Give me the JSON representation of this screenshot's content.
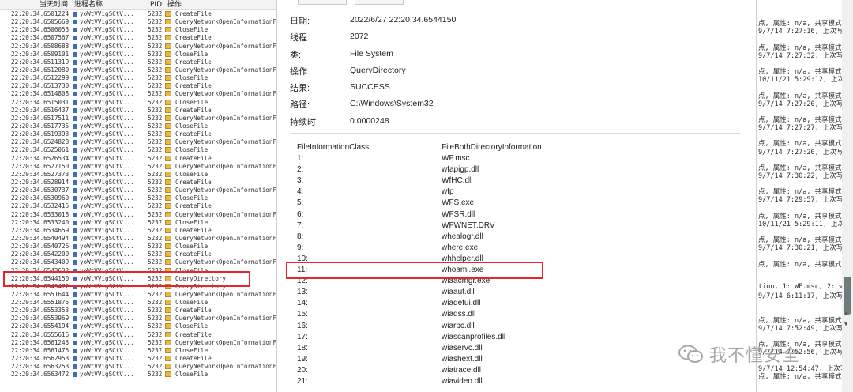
{
  "list": {
    "columns": {
      "time": "当天时间",
      "process": "进程名称",
      "pid": "PID",
      "operation": "操作"
    },
    "rows": [
      {
        "time": "22:20:34.6501224",
        "process": "yoWtVVigSCtV...",
        "pid": "5232",
        "op": "CreateFile"
      },
      {
        "time": "22:20:34.6505669",
        "process": "yoWtVVigSCtV...",
        "pid": "5232",
        "op": "QueryNetworkOpenInformationF"
      },
      {
        "time": "22:20:34.6506053",
        "process": "yoWtVVigSCtV...",
        "pid": "5232",
        "op": "CloseFile"
      },
      {
        "time": "22:20:34.6507567",
        "process": "yoWtVVigSCtV...",
        "pid": "5232",
        "op": "CreateFile"
      },
      {
        "time": "22:20:34.6508688",
        "process": "yoWtVVigSCtV...",
        "pid": "5232",
        "op": "QueryNetworkOpenInformationF"
      },
      {
        "time": "22:20:34.6509101",
        "process": "yoWtVVigSCtV...",
        "pid": "5232",
        "op": "CloseFile"
      },
      {
        "time": "22:20:34.6511319",
        "process": "yoWtVVigSCtV...",
        "pid": "5232",
        "op": "CreateFile"
      },
      {
        "time": "22:20:34.6512080",
        "process": "yoWtVVigSCtV...",
        "pid": "5232",
        "op": "QueryNetworkOpenInformationF"
      },
      {
        "time": "22:20:34.6512299",
        "process": "yoWtVVigSCtV...",
        "pid": "5232",
        "op": "CloseFile"
      },
      {
        "time": "22:20:34.6513730",
        "process": "yoWtVVigSCtV...",
        "pid": "5232",
        "op": "CreateFile"
      },
      {
        "time": "22:20:34.6514808",
        "process": "yoWtVVigSCtV...",
        "pid": "5232",
        "op": "QueryNetworkOpenInformationF"
      },
      {
        "time": "22:20:34.6515031",
        "process": "yoWtVVigSCtV...",
        "pid": "5232",
        "op": "CloseFile"
      },
      {
        "time": "22:20:34.6516437",
        "process": "yoWtVVigSCtV...",
        "pid": "5232",
        "op": "CreateFile"
      },
      {
        "time": "22:20:34.6517511",
        "process": "yoWtVVigSCtV...",
        "pid": "5232",
        "op": "QueryNetworkOpenInformationF"
      },
      {
        "time": "22:20:34.6517735",
        "process": "yoWtVVigSCtV...",
        "pid": "5232",
        "op": "CloseFile"
      },
      {
        "time": "22:20:34.6519393",
        "process": "yoWtVVigSCtV...",
        "pid": "5232",
        "op": "CreateFile"
      },
      {
        "time": "22:20:34.6524828",
        "process": "yoWtVVigSCtV...",
        "pid": "5232",
        "op": "QueryNetworkOpenInformationF"
      },
      {
        "time": "22:20:34.6525061",
        "process": "yoWtVVigSCtV...",
        "pid": "5232",
        "op": "CloseFile"
      },
      {
        "time": "22:20:34.6526534",
        "process": "yoWtVVigSCtV...",
        "pid": "5232",
        "op": "CreateFile"
      },
      {
        "time": "22:20:34.6527150",
        "process": "yoWtVVigSCtV...",
        "pid": "5232",
        "op": "QueryNetworkOpenInformationF"
      },
      {
        "time": "22:20:34.6527373",
        "process": "yoWtVVigSCtV...",
        "pid": "5232",
        "op": "CloseFile"
      },
      {
        "time": "22:20:34.6528914",
        "process": "yoWtVVigSCtV...",
        "pid": "5232",
        "op": "CreateFile"
      },
      {
        "time": "22:20:34.6530737",
        "process": "yoWtVVigSCtV...",
        "pid": "5232",
        "op": "QueryNetworkOpenInformationF"
      },
      {
        "time": "22:20:34.6530960",
        "process": "yoWtVVigSCtV...",
        "pid": "5232",
        "op": "CloseFile"
      },
      {
        "time": "22:20:34.6532415",
        "process": "yoWtVVigSCtV...",
        "pid": "5232",
        "op": "CreateFile"
      },
      {
        "time": "22:20:34.6533018",
        "process": "yoWtVVigSCtV...",
        "pid": "5232",
        "op": "QueryNetworkOpenInformationF"
      },
      {
        "time": "22:20:34.6533240",
        "process": "yoWtVVigSCtV...",
        "pid": "5232",
        "op": "CloseFile"
      },
      {
        "time": "22:20:34.6534659",
        "process": "yoWtVVigSCtV...",
        "pid": "5232",
        "op": "CreateFile"
      },
      {
        "time": "22:20:34.6540494",
        "process": "yoWtVVigSCtV...",
        "pid": "5232",
        "op": "QueryNetworkOpenInformationF"
      },
      {
        "time": "22:20:34.6540726",
        "process": "yoWtVVigSCtV...",
        "pid": "5232",
        "op": "CloseFile"
      },
      {
        "time": "22:20:34.6542200",
        "process": "yoWtVVigSCtV...",
        "pid": "5232",
        "op": "CreateFile"
      },
      {
        "time": "22:20:34.6543409",
        "process": "yoWtVVigSCtV...",
        "pid": "5232",
        "op": "QueryNetworkOpenInformationF"
      },
      {
        "time": "22:20:34.6543632",
        "process": "yoWtVVigSCtV...",
        "pid": "5232",
        "op": "CloseFile"
      },
      {
        "time": "22:20:34.6544150",
        "process": "yoWtVVigSCtV...",
        "pid": "5232",
        "op": "QueryDirectory"
      },
      {
        "time": "22:20:34.6549472",
        "process": "yoWtVVigSCtV...",
        "pid": "5232",
        "op": "QueryDirectory"
      },
      {
        "time": "22:20:34.6551644",
        "process": "yoWtVVigSCtV...",
        "pid": "5232",
        "op": "QueryNetworkOpenInformationF"
      },
      {
        "time": "22:20:34.6551875",
        "process": "yoWtVVigSCtV...",
        "pid": "5232",
        "op": "CloseFile"
      },
      {
        "time": "22:20:34.6553353",
        "process": "yoWtVVigSCtV...",
        "pid": "5232",
        "op": "CreateFile"
      },
      {
        "time": "22:20:34.6553969",
        "process": "yoWtVVigSCtV...",
        "pid": "5232",
        "op": "QueryNetworkOpenInformationF"
      },
      {
        "time": "22:20:34.6554194",
        "process": "yoWtVVigSCtV...",
        "pid": "5232",
        "op": "CloseFile"
      },
      {
        "time": "22:20:34.6555616",
        "process": "yoWtVVigSCtV...",
        "pid": "5232",
        "op": "CreateFile"
      },
      {
        "time": "22:20:34.6561243",
        "process": "yoWtVVigSCtV...",
        "pid": "5232",
        "op": "QueryNetworkOpenInformationF"
      },
      {
        "time": "22:20:34.6561475",
        "process": "yoWtVVigSCtV...",
        "pid": "5232",
        "op": "CloseFile"
      },
      {
        "time": "22:20:34.6562953",
        "process": "yoWtVVigSCtV...",
        "pid": "5232",
        "op": "CreateFile"
      },
      {
        "time": "22:20:34.6563253",
        "process": "yoWtVVigSCtV...",
        "pid": "5232",
        "op": "QueryNetworkOpenInformationF"
      },
      {
        "time": "22:20:34.6563472",
        "process": "yoWtVVigSCtV...",
        "pid": "5232",
        "op": "CloseFile"
      }
    ]
  },
  "event": {
    "date_label": "日期:",
    "date": "2022/6/27 22:20:34.6544150",
    "thread_label": "线程:",
    "thread": "2072",
    "class_label": "类:",
    "class": "File System",
    "operation_label": "操作:",
    "operation": "QueryDirectory",
    "result_label": "结果:",
    "result": "SUCCESS",
    "path_label": "路径:",
    "path": "C:\\Windows\\System32",
    "duration_label": "持续时",
    "duration": "0.0000248"
  },
  "details": {
    "header_key": "FileInformationClass:",
    "header_value": "FileBothDirectoryInformation",
    "items": [
      {
        "key": "1:",
        "value": "WF.msc"
      },
      {
        "key": "2:",
        "value": "wfapigp.dll"
      },
      {
        "key": "3:",
        "value": "WfHC.dll"
      },
      {
        "key": "4:",
        "value": "wfp"
      },
      {
        "key": "5:",
        "value": "WFS.exe"
      },
      {
        "key": "6:",
        "value": "WFSR.dll"
      },
      {
        "key": "7:",
        "value": "WFWNET.DRV"
      },
      {
        "key": "8:",
        "value": "whealogr.dll"
      },
      {
        "key": "9:",
        "value": "where.exe"
      },
      {
        "key": "10:",
        "value": "whhelper.dll"
      },
      {
        "key": "11:",
        "value": "whoami.exe"
      },
      {
        "key": "12:",
        "value": "wiaacmgr.exe"
      },
      {
        "key": "13:",
        "value": "wiaaut.dll"
      },
      {
        "key": "14:",
        "value": "wiadefui.dll"
      },
      {
        "key": "15:",
        "value": "wiadss.dll"
      },
      {
        "key": "16:",
        "value": "wiarpc.dll"
      },
      {
        "key": "17:",
        "value": "wiascanprofiles.dll"
      },
      {
        "key": "18:",
        "value": "wiaservc.dll"
      },
      {
        "key": "19:",
        "value": "wiashext.dll"
      },
      {
        "key": "20:",
        "value": "wiatrace.dll"
      },
      {
        "key": "21:",
        "value": "wiavideo.dll"
      }
    ]
  },
  "right_log": [
    {
      "t": "点, 属性: n/a, 共享模式",
      "row": 1
    },
    {
      "t": "9/7/14 7:27:16, 上次写入",
      "row": 2
    },
    {
      "t": "点, 属性: n/a, 共享模式",
      "row": 4
    },
    {
      "t": "9/7/14 7:27:32, 上次写入",
      "row": 5
    },
    {
      "t": "点, 属性: n/a, 共享模式",
      "row": 7
    },
    {
      "t": "10/11/21 5:29:12, 上次写",
      "row": 8
    },
    {
      "t": "点, 属性: n/a, 共享模式",
      "row": 10
    },
    {
      "t": "9/7/14 7:27:20, 上次写入",
      "row": 11
    },
    {
      "t": "点, 属性: n/a, 共享模式",
      "row": 13
    },
    {
      "t": "9/7/14 7:27:27, 上次写入",
      "row": 14
    },
    {
      "t": "点, 属性: n/a, 共享模式",
      "row": 16
    },
    {
      "t": "9/7/14 7:27:20, 上次写入",
      "row": 17
    },
    {
      "t": "点, 属性: n/a, 共享模式",
      "row": 19
    },
    {
      "t": "9/7/14 7:30:22, 上次写入",
      "row": 20
    },
    {
      "t": "点, 属性: n/a, 共享模式",
      "row": 22
    },
    {
      "t": "9/7/14 7:29:57, 上次写入",
      "row": 23
    },
    {
      "t": "点, 属性: n/a, 共享模式",
      "row": 25
    },
    {
      "t": "10/11/21 5:29:11, 上次写",
      "row": 26
    },
    {
      "t": "点, 属性: n/a, 共享模式",
      "row": 28
    },
    {
      "t": "9/7/14 7:30:21, 上次写入",
      "row": 29
    },
    {
      "t": "点, 属性: n/a, 共享模式",
      "row": 31
    },
    {
      "t": "tion, 1: WF.msc, 2: wfap",
      "row": 34
    },
    {
      "t": "9/7/14 6:11:17, 上次写入",
      "row": 35
    },
    {
      "t": "点, 属性: n/a, 共享模式",
      "row": 38
    },
    {
      "t": "9/7/14 7:52:49, 上次写入",
      "row": 39
    },
    {
      "t": "点, 属性: n/a, 共享模式",
      "row": 41
    },
    {
      "t": "9/7/14 7:52:56, 上次写入",
      "row": 42
    },
    {
      "t": "9/7/14 12:54:47, 上次写",
      "row": 44
    },
    {
      "t": "点, 属性: n/a, 共享模式",
      "row": 45
    }
  ],
  "watermark": {
    "text": "我不懂安全"
  },
  "colors": {
    "highlight": "#e8242c",
    "scroll_thumb": "#6f7c7e"
  }
}
